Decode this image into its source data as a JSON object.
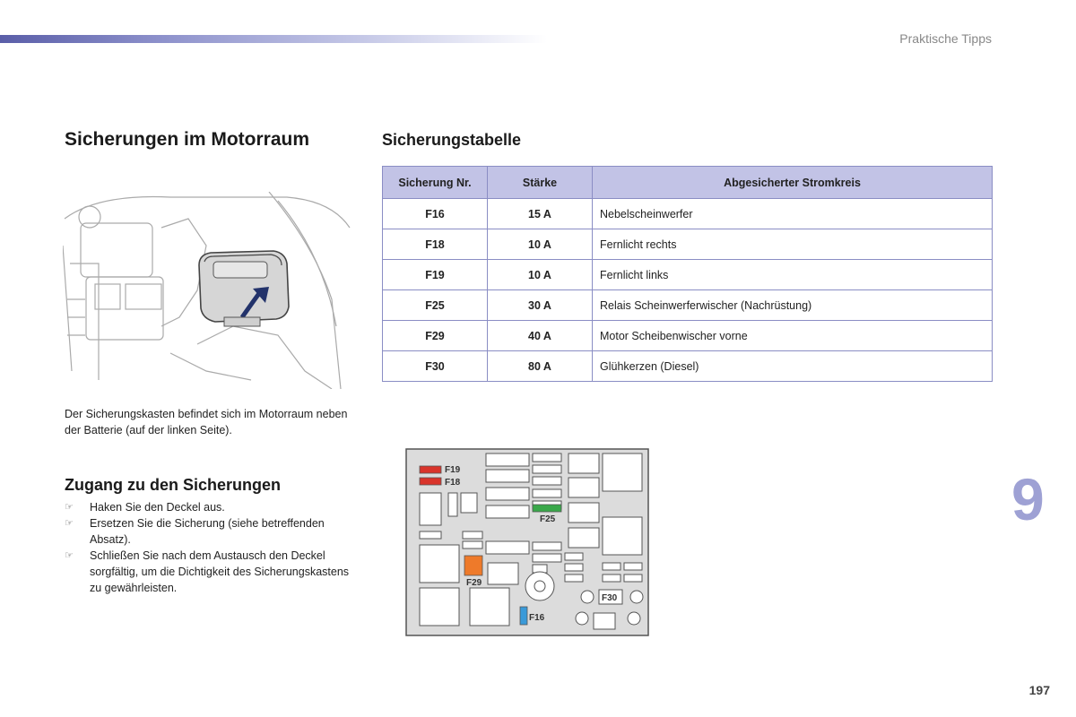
{
  "header": {
    "section_label": "Praktische Tipps"
  },
  "left": {
    "title": "Sicherungen im Motorraum",
    "caption": "Der Sicherungskasten befindet sich im Motorraum neben der Batterie (auf der linken Seite).",
    "access_title": "Zugang zu den Sicherungen",
    "bullet_glyph": "☞",
    "steps": [
      "Haken Sie den Deckel aus.",
      "Ersetzen Sie die Sicherung (siehe betreffenden Absatz).",
      "Schließen Sie nach dem Austausch den Deckel sorgfältig, um die Dichtigkeit des Sicherungskastens zu gewährleisten."
    ]
  },
  "table": {
    "title": "Sicherungstabelle",
    "headers": [
      "Sicherung Nr.",
      "Stärke",
      "Abgesicherter Stromkreis"
    ],
    "rows": [
      [
        "F16",
        "15 A",
        "Nebelscheinwerfer"
      ],
      [
        "F18",
        "10 A",
        "Fernlicht rechts"
      ],
      [
        "F19",
        "10 A",
        "Fernlicht links"
      ],
      [
        "F25",
        "30 A",
        "Relais Scheinwerferwischer (Nachrüstung)"
      ],
      [
        "F29",
        "40 A",
        "Motor Scheibenwischer vorne"
      ],
      [
        "F30",
        "80 A",
        "Glühkerzen (Diesel)"
      ]
    ]
  },
  "fusebox": {
    "labels": {
      "f19": "F19",
      "f18": "F18",
      "f25": "F25",
      "f29": "F29",
      "f30": "F30",
      "f16": "F16"
    },
    "colors": {
      "red": "#d9342b",
      "green": "#3aa84a",
      "orange": "#ee7a2a",
      "blue": "#3a9ad9",
      "bg": "#dcdcdc"
    }
  },
  "footer": {
    "chapter": "9",
    "page": "197"
  },
  "colors": {
    "accent": "#8a8dc4",
    "table_header": "#c2c3e6",
    "chapter": "#9ea1d4"
  }
}
